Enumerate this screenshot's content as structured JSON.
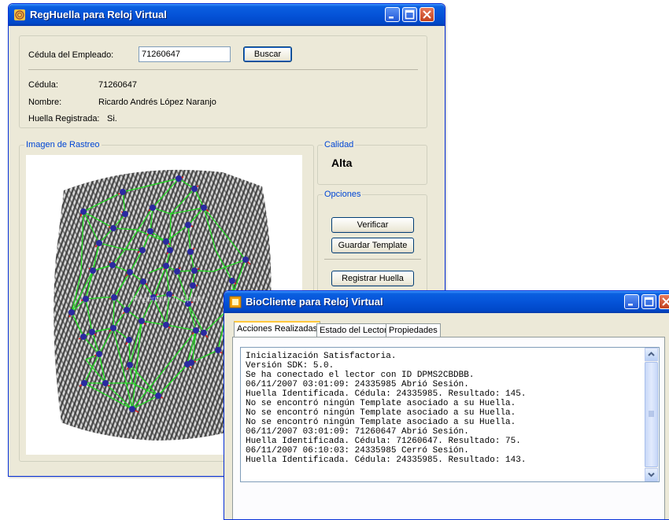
{
  "main_window": {
    "title": "RegHuella para Reloj Virtual",
    "search": {
      "label": "Cédula del Empleado:",
      "value": "71260647",
      "button": "Buscar"
    },
    "info": {
      "cedula_label": "Cédula:",
      "cedula_value": "71260647",
      "nombre_label": "Nombre:",
      "nombre_value": "Ricardo Andrés López Naranjo",
      "huella_label": "Huella Registrada:",
      "huella_value": "Si."
    },
    "image_group": {
      "legend": "Imagen de Rastreo",
      "watermark": "Fingerprint Template"
    },
    "quality": {
      "legend": "Calidad",
      "value": "Alta"
    },
    "options": {
      "legend": "Opciones",
      "verify": "Verificar",
      "save": "Guardar Template",
      "register": "Registrar Huella"
    }
  },
  "bio_window": {
    "title": "BioCliente para Reloj Virtual",
    "tabs": [
      "Acciones Realizadas",
      "Estado del Lector",
      "Propiedades"
    ],
    "active_tab": "Acciones Realizadas",
    "log": [
      "Inicialización Satisfactoria.",
      "Versión SDK: 5.0.",
      "Se ha conectado el lector con ID DPMS2CBDBB.",
      "06/11/2007 03:01:09: 24335985 Abrió Sesión.",
      "Huella Identificada. Cédula: 24335985. Resultado: 145.",
      "No se encontró ningún Template asociado a su Huella.",
      "No se encontró ningún Template asociado a su Huella.",
      "No se encontró ningún Template asociado a su Huella.",
      "06/11/2007 03:01:09: 71260647 Abrió Sesión.",
      "Huella Identificada. Cédula: 71260647. Resultado: 75.",
      "06/11/2007 06:10:03: 24335985 Cerró Sesión.",
      "Huella Identificada. Cédula: 24335985. Resultado: 143."
    ]
  },
  "colors": {
    "titlebar": "#0553d8",
    "group_legend": "#0046d5",
    "minutia_line": "#22dd22",
    "minutia_dot": "#2a2aa0"
  }
}
